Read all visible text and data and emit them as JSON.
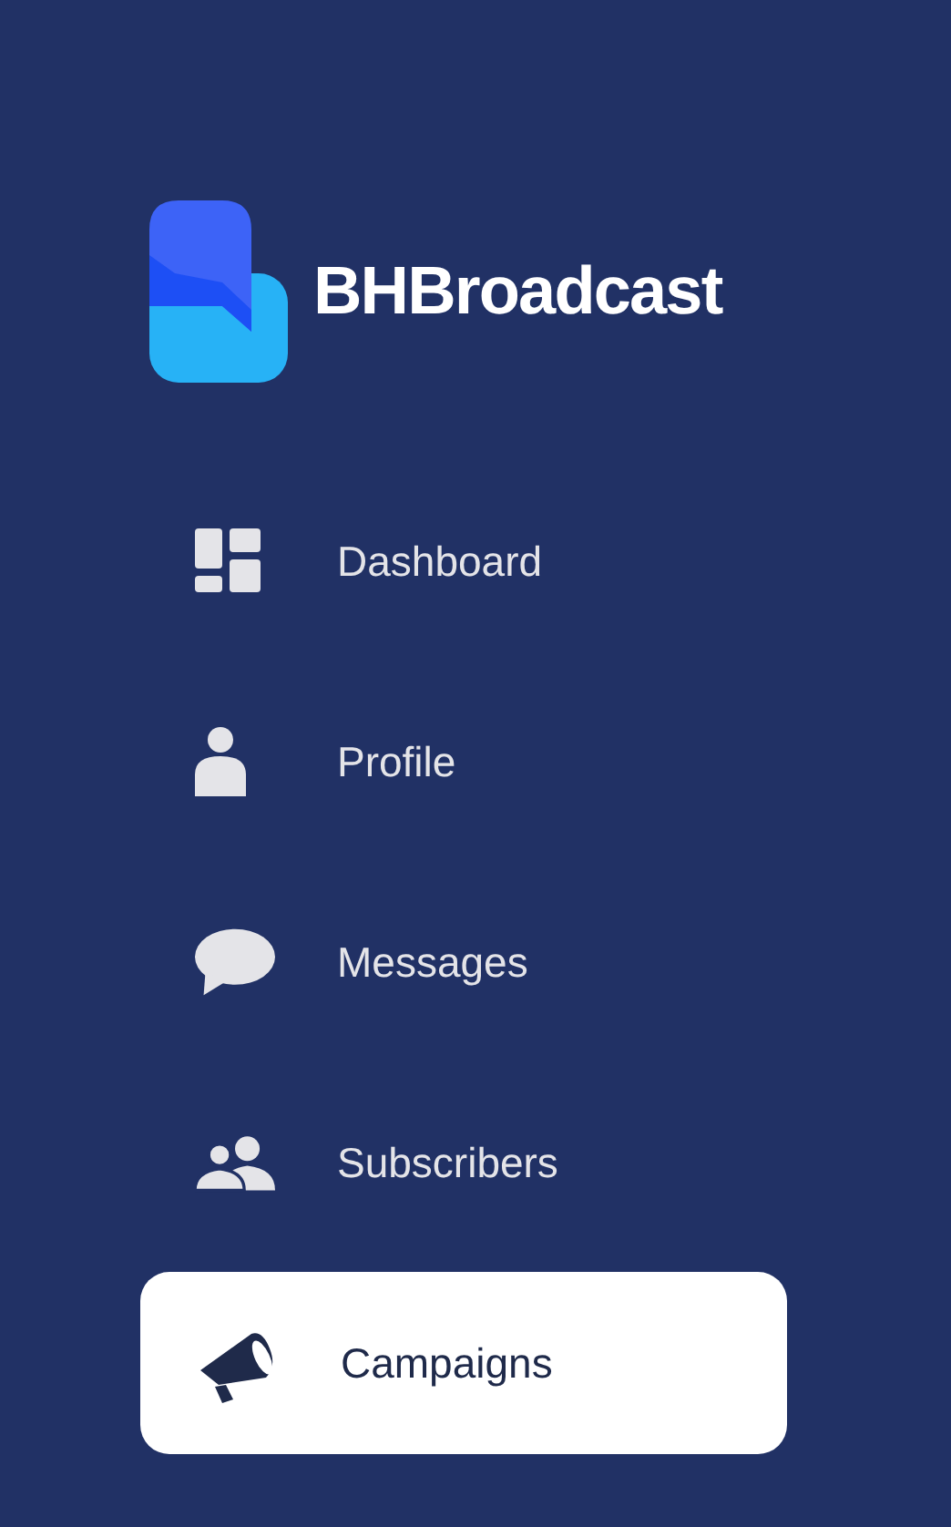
{
  "brand": {
    "name": "BHBroadcast"
  },
  "nav": [
    {
      "label": "Dashboard",
      "kind": "dashboard",
      "selected": false
    },
    {
      "label": "Profile",
      "kind": "profile",
      "selected": false
    },
    {
      "label": "Messages",
      "kind": "messages",
      "selected": false
    },
    {
      "label": "Subscribers",
      "kind": "subscribers",
      "selected": false
    },
    {
      "label": "Campaigns",
      "kind": "campaigns",
      "selected": true
    }
  ]
}
